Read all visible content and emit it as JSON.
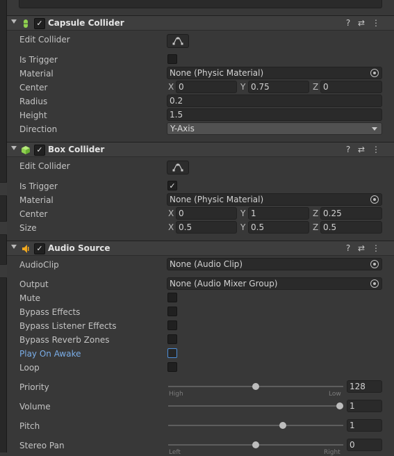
{
  "capsule": {
    "title": "Capsule Collider",
    "edit_collider_label": "Edit Collider",
    "is_trigger_label": "Is Trigger",
    "material_label": "Material",
    "material_value": "None (Physic Material)",
    "center_label": "Center",
    "center": {
      "x_axis": "X",
      "x": "0",
      "y_axis": "Y",
      "y": "0.75",
      "z_axis": "Z",
      "z": "0"
    },
    "radius_label": "Radius",
    "radius": "0.2",
    "height_label": "Height",
    "height": "1.5",
    "direction_label": "Direction",
    "direction": "Y-Axis"
  },
  "box": {
    "title": "Box Collider",
    "edit_collider_label": "Edit Collider",
    "is_trigger_label": "Is Trigger",
    "is_trigger_checked": "✓",
    "material_label": "Material",
    "material_value": "None (Physic Material)",
    "center_label": "Center",
    "center": {
      "x_axis": "X",
      "x": "0",
      "y_axis": "Y",
      "y": "1",
      "z_axis": "Z",
      "z": "0.25"
    },
    "size_label": "Size",
    "size": {
      "x_axis": "X",
      "x": "0.5",
      "y_axis": "Y",
      "y": "0.5",
      "z_axis": "Z",
      "z": "0.5"
    }
  },
  "audio": {
    "title": "Audio Source",
    "audioclip_label": "AudioClip",
    "audioclip_value": "None (Audio Clip)",
    "output_label": "Output",
    "output_value": "None (Audio Mixer Group)",
    "mute_label": "Mute",
    "bypass_effects_label": "Bypass Effects",
    "bypass_listener_label": "Bypass Listener Effects",
    "bypass_reverb_label": "Bypass Reverb Zones",
    "play_on_awake_label": "Play On Awake",
    "loop_label": "Loop",
    "priority_label": "Priority",
    "priority_value": "128",
    "priority_fraction": 0.5,
    "priority_low_hint": "High",
    "priority_high_hint": "Low",
    "volume_label": "Volume",
    "volume_value": "1",
    "volume_fraction": 1.0,
    "pitch_label": "Pitch",
    "pitch_value": "1",
    "pitch_fraction": 0.66,
    "stereo_pan_label": "Stereo Pan",
    "stereo_pan_value": "0",
    "stereo_pan_fraction": 0.5,
    "pan_left_hint": "Left",
    "pan_right_hint": "Right"
  },
  "icons": {
    "checkmark": "✓",
    "help": "?",
    "presets": "⇄",
    "menu": "⋮"
  },
  "colors": {
    "capsule_icon": "#8fd14f",
    "box_icon": "#8fd14f",
    "audio_icon": "#f0a81e",
    "highlight_label": "#7baee8"
  }
}
